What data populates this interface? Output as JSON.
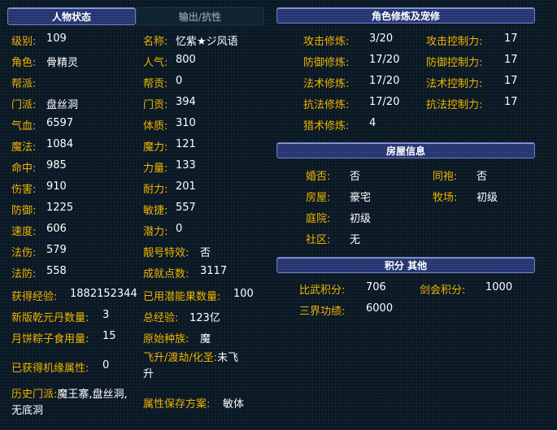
{
  "tabs": {
    "character_status": "人物状态",
    "output_resist": "输出/抗性"
  },
  "headers": {
    "cultivation": "角色修炼及宠修",
    "house": "房屋信息",
    "points": "积分 其他"
  },
  "left_col_a": [
    {
      "label": "级别:",
      "value": "109"
    },
    {
      "label": "角色:",
      "value": "骨精灵"
    },
    {
      "label": "帮派:",
      "value": ""
    },
    {
      "label": "门派:",
      "value": "盘丝洞"
    },
    {
      "label": "气血:",
      "value": "6597"
    },
    {
      "label": "魔法:",
      "value": "1084"
    },
    {
      "label": "命中:",
      "value": "985"
    },
    {
      "label": "伤害:",
      "value": "910"
    },
    {
      "label": "防御:",
      "value": "1225"
    },
    {
      "label": "速度:",
      "value": "606"
    },
    {
      "label": "法伤:",
      "value": "579"
    },
    {
      "label": "法防:",
      "value": "558"
    }
  ],
  "left_col_b": [
    {
      "label": "名称:",
      "value": "忆紫★ジ风语"
    },
    {
      "label": "人气:",
      "value": "800"
    },
    {
      "label": "帮贡:",
      "value": "0"
    },
    {
      "label": "门贡:",
      "value": "394"
    },
    {
      "label": "体质:",
      "value": "310"
    },
    {
      "label": "魔力:",
      "value": "121"
    },
    {
      "label": "力量:",
      "value": "133"
    },
    {
      "label": "耐力:",
      "value": "201"
    },
    {
      "label": "敏捷:",
      "value": "557"
    },
    {
      "label": "潜力:",
      "value": "0"
    },
    {
      "label": "靓号特效:",
      "value": "否"
    },
    {
      "label": "成就点数:",
      "value": "3117"
    }
  ],
  "extra": {
    "exp_label": "获得经验:",
    "exp_value": "1882152344",
    "potential_label": "已用潜能果数量:",
    "potential_value": "100",
    "qianyuan_label": "新版乾元丹数量:",
    "qianyuan_value": "3",
    "total_exp_label": "总经验:",
    "total_exp_value": "123亿",
    "zongzi_label": "月饼粽子食用量:",
    "zongzi_value": "15",
    "race_label": "原始种族:",
    "race_value": "魔",
    "jiyuan_label": "已获得机缘属性:",
    "jiyuan_value": "0",
    "feisheng_label": "飞升/渡劫/化圣:",
    "feisheng_value": "未飞升",
    "history_label": "历史门派:",
    "history_value": "魔王寨,盘丝洞,无底洞",
    "scheme_label": "属性保存方案:",
    "scheme_value": "敏体"
  },
  "cultivation": [
    {
      "label": "攻击修炼:",
      "value": "3/20",
      "label2": "攻击控制力:",
      "value2": "17"
    },
    {
      "label": "防御修炼:",
      "value": "17/20",
      "label2": "防御控制力:",
      "value2": "17"
    },
    {
      "label": "法术修炼:",
      "value": "17/20",
      "label2": "法术控制力:",
      "value2": "17"
    },
    {
      "label": "抗法修炼:",
      "value": "17/20",
      "label2": "抗法控制力:",
      "value2": "17"
    },
    {
      "label": "猎术修炼:",
      "value": "4"
    }
  ],
  "house": [
    {
      "label": "婚否:",
      "value": "否",
      "label2": "同袍:",
      "value2": "否"
    },
    {
      "label": "房屋:",
      "value": "豪宅",
      "label2": "牧场:",
      "value2": "初级"
    },
    {
      "label": "庭院:",
      "value": "初级"
    },
    {
      "label": "社区:",
      "value": "无"
    }
  ],
  "points": {
    "pk_label": "比武积分:",
    "pk_value": "706",
    "sword_label": "剑会积分:",
    "sword_value": "1000",
    "merit_label": "三界功绩:",
    "merit_value": "6000"
  }
}
